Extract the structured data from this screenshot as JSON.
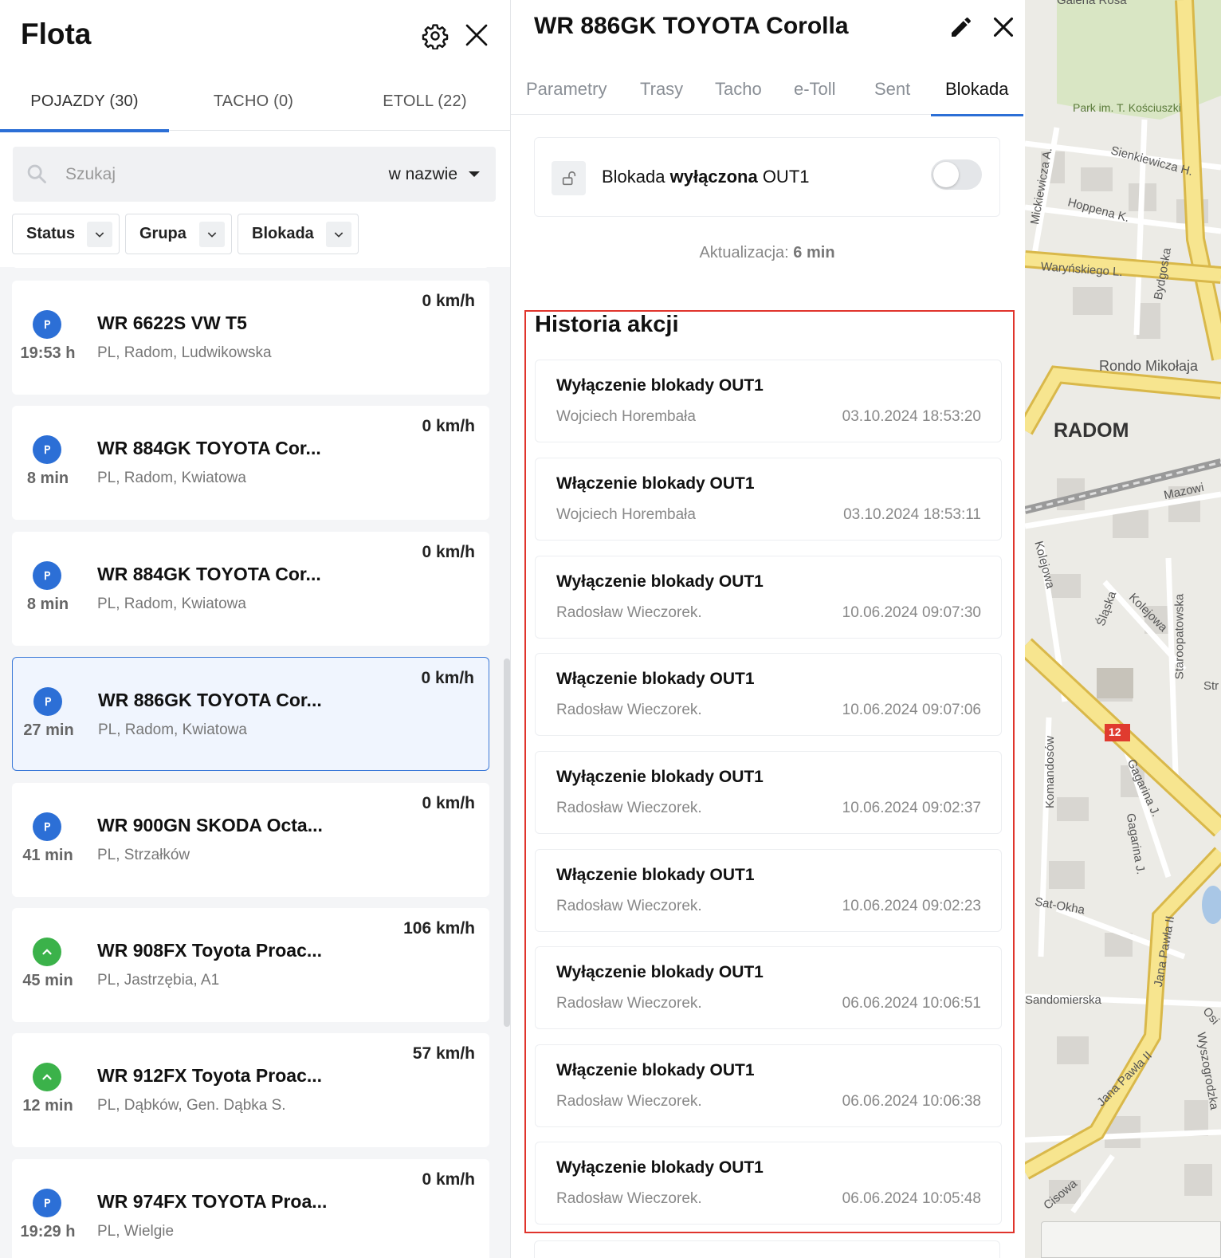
{
  "fleet": {
    "title": "Flota",
    "tabs": [
      {
        "label": "POJAZDY (30)",
        "active": true
      },
      {
        "label": "TACHO (0)",
        "active": false
      },
      {
        "label": "ETOLL (22)",
        "active": false
      }
    ],
    "search": {
      "placeholder": "Szukaj",
      "value": "",
      "mode": "w nazwie"
    },
    "filters": [
      {
        "label": "Status"
      },
      {
        "label": "Grupa"
      },
      {
        "label": "Blokada"
      }
    ],
    "vehicles": [
      {
        "name": "WR 6622S VW T5",
        "address": "PL, Radom, Ludwikowska",
        "time": "19:53 h",
        "speed": "0 km/h",
        "status": "park",
        "selected": false
      },
      {
        "name": "WR 884GK TOYOTA Cor...",
        "address": "PL, Radom, Kwiatowa",
        "time": "8 min",
        "speed": "0 km/h",
        "status": "park",
        "selected": false
      },
      {
        "name": "WR 884GK TOYOTA Cor...",
        "address": "PL, Radom, Kwiatowa",
        "time": "8 min",
        "speed": "0 km/h",
        "status": "park",
        "selected": false
      },
      {
        "name": "WR 886GK TOYOTA Cor...",
        "address": "PL, Radom, Kwiatowa",
        "time": "27 min",
        "speed": "0 km/h",
        "status": "park",
        "selected": true
      },
      {
        "name": "WR 900GN SKODA Octa...",
        "address": "PL, Strzałków",
        "time": "41 min",
        "speed": "0 km/h",
        "status": "park",
        "selected": false
      },
      {
        "name": "WR 908FX Toyota Proac...",
        "address": "PL, Jastrzębia, A1",
        "time": "45 min",
        "speed": "106 km/h",
        "status": "move",
        "selected": false
      },
      {
        "name": "WR 912FX Toyota Proac...",
        "address": "PL, Dąbków, Gen. Dąbka S.",
        "time": "12 min",
        "speed": "57 km/h",
        "status": "move",
        "selected": false
      },
      {
        "name": "WR 974FX TOYOTA Proa...",
        "address": "PL, Wielgie",
        "time": "19:29 h",
        "speed": "0 km/h",
        "status": "park",
        "selected": false
      }
    ]
  },
  "detail": {
    "title": "WR 886GK TOYOTA Corolla",
    "tabs": [
      {
        "label": "Parametry",
        "active": false
      },
      {
        "label": "Trasy",
        "active": false
      },
      {
        "label": "Tacho",
        "active": false
      },
      {
        "label": "e-Toll",
        "active": false
      },
      {
        "label": "Sent",
        "active": false
      },
      {
        "label": "Blokada",
        "active": true
      }
    ],
    "block": {
      "prefix": "Blokada",
      "state": "wyłączona",
      "output": "OUT1",
      "enabled": false
    },
    "update": {
      "label": "Aktualizacja:",
      "value": "6 min"
    },
    "history": {
      "title": "Historia akcji",
      "items": [
        {
          "action": "Wyłączenie blokady OUT1",
          "user": "Wojciech Horembała",
          "date": "03.10.2024 18:53:20"
        },
        {
          "action": "Włączenie blokady OUT1",
          "user": "Wojciech Horembała",
          "date": "03.10.2024 18:53:11"
        },
        {
          "action": "Wyłączenie blokady OUT1",
          "user": "Radosław Wieczorek.",
          "date": "10.06.2024 09:07:30"
        },
        {
          "action": "Włączenie blokady OUT1",
          "user": "Radosław Wieczorek.",
          "date": "10.06.2024 09:07:06"
        },
        {
          "action": "Wyłączenie blokady OUT1",
          "user": "Radosław Wieczorek.",
          "date": "10.06.2024 09:02:37"
        },
        {
          "action": "Włączenie blokady OUT1",
          "user": "Radosław Wieczorek.",
          "date": "10.06.2024 09:02:23"
        },
        {
          "action": "Wyłączenie blokady OUT1",
          "user": "Radosław Wieczorek.",
          "date": "06.06.2024 10:06:51"
        },
        {
          "action": "Włączenie blokady OUT1",
          "user": "Radosław Wieczorek.",
          "date": "06.06.2024 10:06:38"
        },
        {
          "action": "Wyłączenie blokady OUT1",
          "user": "Radosław Wieczorek.",
          "date": "06.06.2024 10:05:48"
        }
      ]
    }
  },
  "map": {
    "city": "RADOM",
    "labels": [
      "Galeria Rosa",
      "Park im. T. Kościuszki",
      "Sienkiewicza H.",
      "Mickiewicza A.",
      "Hoppena K.",
      "Waryńskiego L.",
      "Bydgoska",
      "Rondo Mikołaja",
      "Mazowi",
      "Kolejowa",
      "Śląska",
      "Kolejowa",
      "Staroopatowska",
      "Str",
      "12",
      "Komandosów",
      "Gagarina J.",
      "Gagarina J.",
      "Sat-Okha",
      "Jana Pawła II",
      "Sandomierska",
      "Osi",
      "Jana Pawła II",
      "Wyszogrodzka",
      "Cisowa"
    ],
    "colors": {
      "main_road": "#f7e58f",
      "road_edge": "#d9b84a",
      "park": "#d9e6c4",
      "block": "#d8d6d1",
      "water": "#a9c7e6"
    }
  }
}
